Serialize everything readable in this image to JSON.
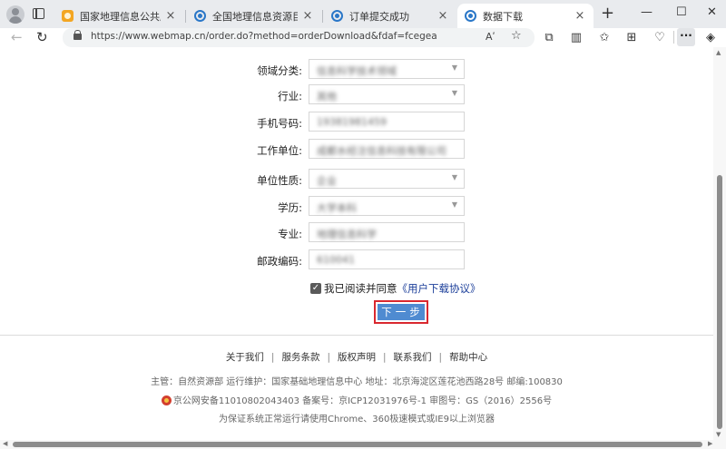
{
  "browser": {
    "tabs": [
      {
        "title": "国家地理信息公共服务平台 天",
        "favicon": "orange-map-icon",
        "active": false
      },
      {
        "title": "全国地理信息资源目录服务系统",
        "favicon": "edge-icon",
        "active": false
      },
      {
        "title": "订单提交成功",
        "favicon": "edge-icon",
        "active": false
      },
      {
        "title": "数据下载",
        "favicon": "edge-icon",
        "active": true
      }
    ],
    "close_glyph": "×",
    "new_tab_glyph": "+",
    "url": "https://www.webmap.cn/order.do?method=orderDownload&fdaf=fcegea",
    "read_aloud_label": "Aʹ"
  },
  "form": {
    "fields": [
      {
        "label": "领域分类:",
        "value": "信息科学技术领域",
        "type": "select"
      },
      {
        "label": "行业:",
        "value": "其他",
        "type": "select"
      },
      {
        "label": "手机号码:",
        "value": "19381981459",
        "type": "text"
      },
      {
        "label": "工作单位:",
        "value": "成都水经注信息科技有限公司",
        "type": "text"
      },
      {
        "label": "单位性质:",
        "value": "企业",
        "type": "select"
      },
      {
        "label": "学历:",
        "value": "大学本科",
        "type": "select"
      },
      {
        "label": "专业:",
        "value": "地理信息科学",
        "type": "text"
      },
      {
        "label": "邮政编码:",
        "value": "610041",
        "type": "text"
      }
    ],
    "agree_prefix": "我已阅读并同意",
    "agree_link": "《用户下载协议》",
    "next_label": "下一步"
  },
  "footer": {
    "links": [
      "关于我们",
      "服务条款",
      "版权声明",
      "联系我们",
      "帮助中心"
    ],
    "info_line": "主管：自然资源部 运行维护：国家基础地理信息中心 地址：北京海淀区莲花池西路28号 邮编:100830",
    "record_line": "京公网安备11010802043403 备案号：京ICP12031976号-1 审图号：GS（2016）2556号",
    "browser_note": "为保证系统正常运行请使用Chrome、360极速模式或IE9以上浏览器"
  },
  "colors": {
    "next_button": "#4f8bd1",
    "next_border": "#d9282f",
    "agree_link": "#1c3f9a"
  }
}
